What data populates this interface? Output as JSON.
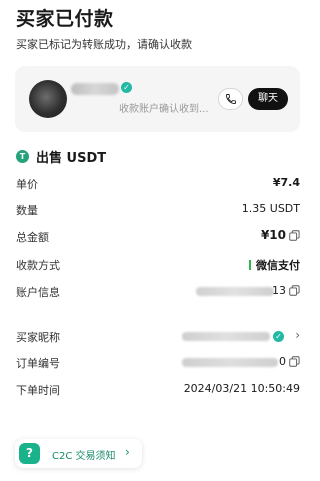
{
  "header": {
    "title": "买家已付款",
    "subtitle": "买家已标记为转账成功，请确认收款"
  },
  "buyer_card": {
    "confirm_text": "收款账户确认收到...",
    "chat_label": "聊天",
    "icons": [
      "avatar",
      "verified-badge-icon",
      "phone-icon"
    ]
  },
  "order": {
    "sell_label": "出售 USDT",
    "token_icon_text": "T",
    "rows": [
      {
        "label": "单价",
        "value": "¥7.4"
      },
      {
        "label": "数量",
        "value": "1.35 USDT"
      },
      {
        "label": "总金额",
        "value": "¥10"
      },
      {
        "label": "收款方式",
        "value": "微信支付"
      },
      {
        "label": "账户信息",
        "value": "13"
      }
    ],
    "buyer_rows": [
      {
        "label": "买家昵称",
        "value": ""
      },
      {
        "label": "订单编号",
        "value": "0"
      },
      {
        "label": "下单时间",
        "value": "2024/03/21 10:50:49"
      }
    ]
  },
  "notice": {
    "icon_text": "?",
    "label": "C2C 交易须知",
    "chevron": "›"
  },
  "colors": {
    "accent_green": "#26a17b",
    "wechat_green": "#2fb64d",
    "badge_teal": "#21b9a4"
  }
}
